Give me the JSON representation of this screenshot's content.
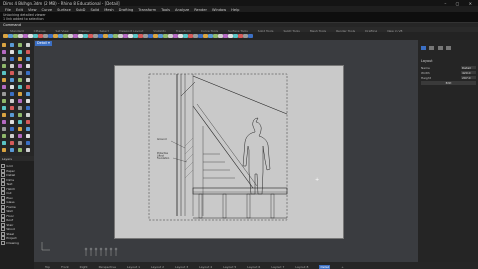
{
  "window": {
    "title": "Dims 4 Bklhgn.3dm (2 MB) - Rhino 8 Educational - [Detail]",
    "controls": "– ▢ ✕"
  },
  "menu": [
    "File",
    "Edit",
    "View",
    "Curve",
    "Surface",
    "SubD",
    "Solid",
    "Mesh",
    "Drafting",
    "Transform",
    "Tools",
    "Analyze",
    "Render",
    "Window",
    "Help"
  ],
  "command": {
    "history": [
      "Unlocking detailed viewer",
      "1 link added to selection"
    ],
    "prompt": "Command"
  },
  "toolbar_tabs": [
    "Standard",
    "CPlanes",
    "Set View",
    "Display",
    "Select",
    "Viewport Layout",
    "Visibility",
    "Transform",
    "Curve Tools",
    "Surface Tools",
    "Solid Tools",
    "SubD Tools",
    "Mesh Tools",
    "Render Tools",
    "Drafting",
    "New in V8"
  ],
  "viewport": {
    "label": "Detail ▾"
  },
  "drawing": {
    "callout_1": "Ground",
    "callout_2": "Protective\nLiftout\nFoundation"
  },
  "layers_panel": {
    "title": "Layers",
    "rows": [
      "Grid",
      "Paper",
      "Detail",
      "Dims",
      "Text",
      "Hatch",
      "Cut",
      "Elev",
      "Glass",
      "Frame",
      "Wall",
      "Floor",
      "Roof",
      "Stair",
      "Wood",
      "Steel",
      "Project",
      "Drawing"
    ]
  },
  "right_panel": {
    "section": "Layout",
    "props": [
      {
        "name": "Name",
        "value": "Detail"
      },
      {
        "name": "Width",
        "value": "420.0 mm"
      },
      {
        "name": "Height",
        "value": "297.0 mm"
      }
    ],
    "button": "Edit"
  },
  "statusbar": {
    "tabs": [
      "Top",
      "Front",
      "Right",
      "Perspective",
      "Layout 1",
      "Layout 2",
      "Layout 3",
      "Layout 4",
      "Layout 5",
      "Layout 6",
      "Layout 7",
      "Layout 8",
      "Detail",
      "+"
    ],
    "active_index": 12
  },
  "colors": {
    "accent": "#3b6fc4",
    "paper": "#c9c9c9",
    "viewport_bg": "#3a3c40"
  }
}
